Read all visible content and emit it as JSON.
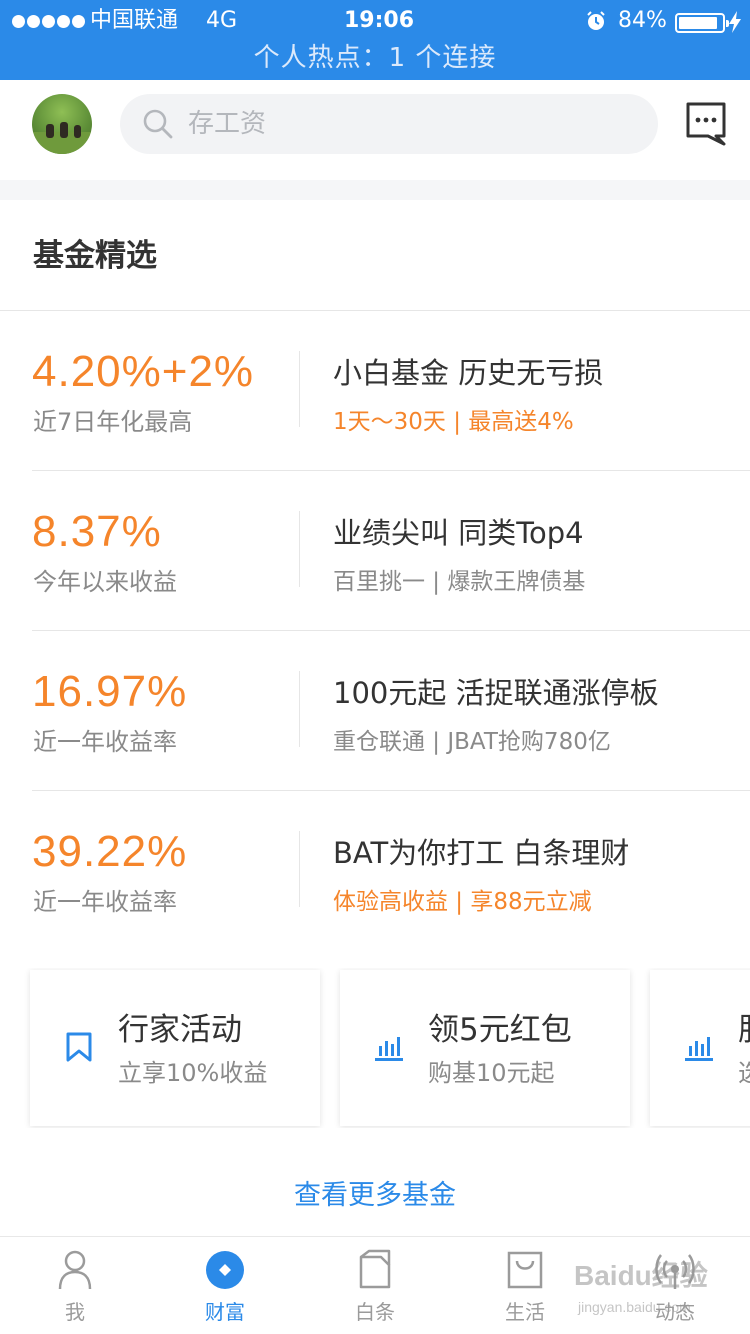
{
  "status_bar": {
    "carrier": "中国联通",
    "network": "4G",
    "time": "19:06",
    "battery": "84%",
    "hotspot": "个人热点：1 个连接"
  },
  "header": {
    "search_placeholder": "存工资",
    "icons": [
      "avatar",
      "search-icon",
      "message-icon"
    ]
  },
  "section": {
    "title": "基金精选"
  },
  "funds": [
    {
      "rate": "4.20%+2%",
      "rate_label": "近7日年化最高",
      "name": "小白基金 历史无亏损",
      "desc": "1天～30天 | 最高送4%",
      "desc_highlight": true
    },
    {
      "rate": "8.37%",
      "rate_label": "今年以来收益",
      "name": "业绩尖叫 同类Top4",
      "desc": "百里挑一 | 爆款王牌债基",
      "desc_highlight": false
    },
    {
      "rate": "16.97%",
      "rate_label": "近一年收益率",
      "name": "100元起  活捉联通涨停板",
      "desc": "重仓联通 | JBAT抢购780亿",
      "desc_highlight": false
    },
    {
      "rate": "39.22%",
      "rate_label": "近一年收益率",
      "name": "BAT为你打工 白条理财",
      "desc": "体验高收益 | 享88元立减",
      "desc_highlight": true
    }
  ],
  "cards": [
    {
      "title": "行家活动",
      "subtitle": "立享10%收益",
      "icon": "bookmark-icon"
    },
    {
      "title": "领5元红包",
      "subtitle": "购基10元起",
      "icon": "bar-chart-icon"
    },
    {
      "title": "服",
      "subtitle": "选",
      "icon": "bar-chart-icon"
    }
  ],
  "more_link": "查看更多基金",
  "tabs": [
    {
      "label": "我",
      "icon": "person-icon",
      "active": false
    },
    {
      "label": "财富",
      "icon": "wealth-icon",
      "active": true
    },
    {
      "label": "白条",
      "icon": "card-icon",
      "active": false
    },
    {
      "label": "生活",
      "icon": "bag-icon",
      "active": false
    },
    {
      "label": "动态",
      "icon": "broadcast-icon",
      "active": false
    }
  ],
  "watermark": {
    "main": "Baidu经验",
    "sub": "jingyan.baidu.com"
  },
  "colors": {
    "brand_blue": "#2b8ae8",
    "accent_orange": "#f5852b",
    "muted_text": "#8a8a8a"
  }
}
